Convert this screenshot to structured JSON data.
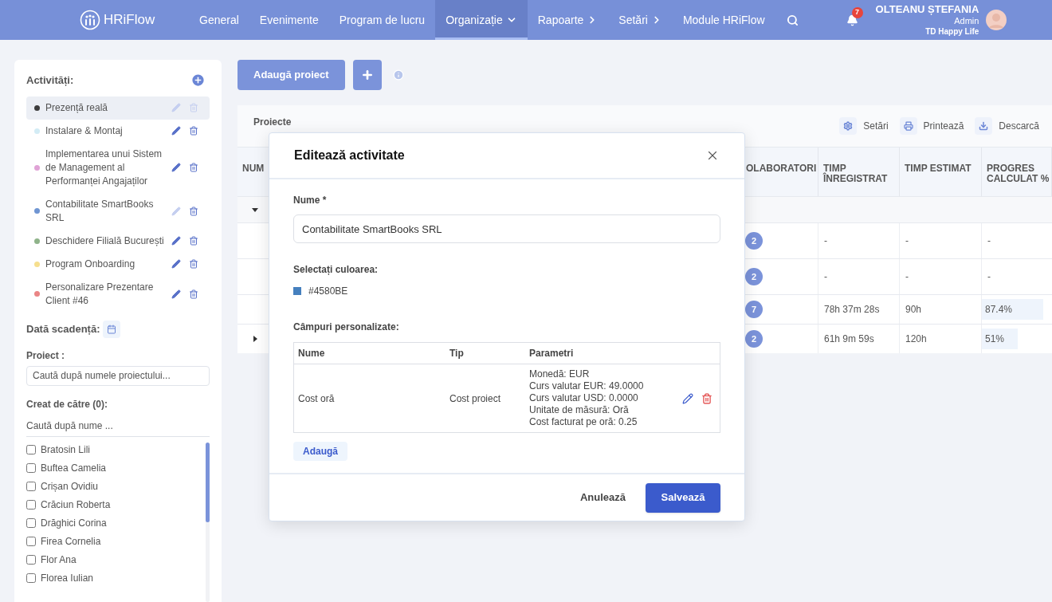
{
  "header": {
    "logo": "HRiFlow",
    "nav": [
      {
        "label": "General",
        "selected": false,
        "kind": "plain"
      },
      {
        "label": "Evenimente",
        "selected": false,
        "kind": "plain"
      },
      {
        "label": "Program de lucru",
        "selected": false,
        "kind": "plain"
      },
      {
        "label": "Organizație",
        "selected": true,
        "kind": "dropdown"
      },
      {
        "label": "Rapoarte",
        "selected": false,
        "kind": "submenu"
      },
      {
        "label": "Setări",
        "selected": false,
        "kind": "submenu"
      },
      {
        "label": "Module HRiFlow",
        "selected": false,
        "kind": "plain"
      }
    ],
    "notifications": "7",
    "user": {
      "name": "OLTEANU ȘTEFANIA",
      "role": "Admin",
      "company": "TD Happy Life"
    }
  },
  "sidebar": {
    "activities_title": "Activități:",
    "activities": [
      {
        "label": "Prezență reală",
        "color": "#3c3c3c",
        "selected": true,
        "editable": false,
        "deletable": false
      },
      {
        "label": "Instalare & Montaj",
        "color": "#d3ecf5",
        "selected": false,
        "editable": true,
        "deletable": true
      },
      {
        "label": "Implementarea unui Sistem de Management al Performanței Angajaților",
        "color": "#e0a3d6",
        "selected": false,
        "editable": true,
        "deletable": true
      },
      {
        "label": "Contabilitate SmartBooks SRL",
        "color": "#6f95d2",
        "selected": false,
        "editable": false,
        "deletable": true
      },
      {
        "label": "Deschidere Filială București",
        "color": "#8fb38a",
        "selected": false,
        "editable": true,
        "deletable": true
      },
      {
        "label": "Program Onboarding",
        "color": "#f6df8e",
        "selected": false,
        "editable": true,
        "deletable": true
      },
      {
        "label": "Personalizare Prezentare Client #46",
        "color": "#ea8585",
        "selected": false,
        "editable": true,
        "deletable": true
      }
    ],
    "due_date_label": "Dată scadență:",
    "project_label": "Proiect :",
    "project_search": {
      "placeholder": "Caută după numele proiectului..."
    },
    "created_by_label": "Creat de către (0):",
    "creator_search": {
      "placeholder": "Caută după nume ..."
    },
    "creators": [
      {
        "label": "Bratosin Lili",
        "checked": false
      },
      {
        "label": "Buftea Camelia",
        "checked": false
      },
      {
        "label": "Crișan Ovidiu",
        "checked": false
      },
      {
        "label": "Crăciun Roberta",
        "checked": false
      },
      {
        "label": "Drăghici Corina",
        "checked": false
      },
      {
        "label": "Firea Cornelia",
        "checked": false
      },
      {
        "label": "Flor Ana",
        "checked": false
      },
      {
        "label": "Florea Iulian",
        "checked": false
      }
    ]
  },
  "main": {
    "add_button": "Adaugă proiect",
    "table_title": "Proiecte",
    "actions": [
      {
        "kind": "settings",
        "label": "Setări"
      },
      {
        "kind": "print",
        "label": "Printează"
      },
      {
        "kind": "download",
        "label": "Descarcă"
      }
    ],
    "columns": [
      "NUM",
      "OLABORATORI",
      "TIMP ÎNREGISTRAT",
      "TIMP ESTIMAT",
      "PROGRES CALCULAT %"
    ],
    "rows": [
      {
        "kind": "group",
        "expanded": true
      },
      {
        "kind": "item",
        "collaborators": "2",
        "time_logged": "-",
        "time_estimated": "-",
        "progress": {
          "text": "-"
        }
      },
      {
        "kind": "item",
        "collaborators": "2",
        "time_logged": "-",
        "time_estimated": "-",
        "progress": {
          "text": "-"
        }
      },
      {
        "kind": "item",
        "collaborators": "7",
        "time_logged": "78h 37m 28s",
        "time_estimated": "90h",
        "progress": {
          "text": "87.4%",
          "level": 0.874
        }
      },
      {
        "kind": "parent",
        "expanded": false,
        "collaborators": "2",
        "time_logged": "61h 9m 59s",
        "time_estimated": "120h",
        "progress": {
          "text": "51%",
          "level": 0.51
        }
      }
    ]
  },
  "modal": {
    "title": "Editează activitate",
    "name_label": "Nume *",
    "name_value": "Contabilitate SmartBooks SRL",
    "color_label": "Selectați culoarea:",
    "color": {
      "text": "#4580BE",
      "color": "#4580be"
    },
    "custom_fields_label": "Câmpuri personalizate:",
    "custom_fields": {
      "columns": [
        "Nume",
        "Tip",
        "Parametri"
      ],
      "rows": [
        {
          "name": "Cost oră",
          "type": "Cost proiect",
          "parameters": [
            "Monedă: EUR",
            "Curs valutar EUR: 49.0000",
            "Curs valutar USD: 0.0000",
            "Unitate de măsură: Oră",
            "Cost facturat pe oră: 0.25"
          ]
        }
      ]
    },
    "add_button": "Adaugă",
    "cancel_button": "Anulează",
    "save_button": "Salvează"
  }
}
